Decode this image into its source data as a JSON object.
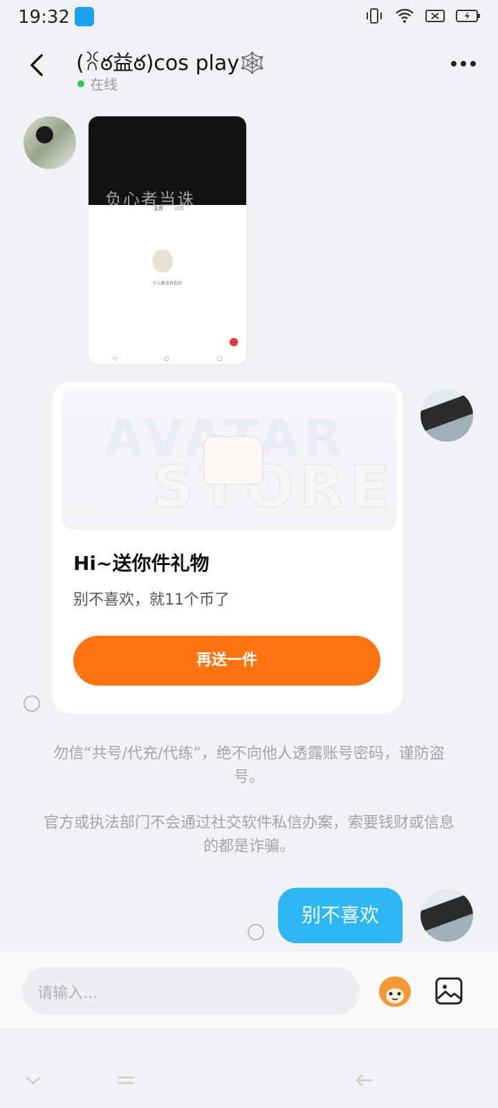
{
  "status_bar": {
    "time": "19:32"
  },
  "header": {
    "title": "(ꐦఠ益ఠ)cos play🕸️",
    "status": "在线"
  },
  "thumbnail": {
    "watermark": "负心者当诛",
    "tab_home": "主页",
    "tab_dynamic": "动态",
    "empty_text": "什么都没有捉到"
  },
  "gift_card": {
    "image_text_top": "AVATAR",
    "image_text_bottom": "STORE",
    "title": "Hi~送你件礼物",
    "subtitle": "别不喜欢，就11个币了",
    "button": "再送一件"
  },
  "notices": [
    "勿信“共号/代充/代练”，绝不向他人透露账号密码，谨防盗号。",
    "官方或执法部门不会通过社交软件私信办案，索要钱财或信息的都是诈骗。"
  ],
  "message": {
    "text": "别不喜欢"
  },
  "composer": {
    "placeholder": "请输入..."
  },
  "colors": {
    "accent_orange": "#ff7411",
    "bubble_blue": "#2eb7f5",
    "online_green": "#35c759"
  }
}
